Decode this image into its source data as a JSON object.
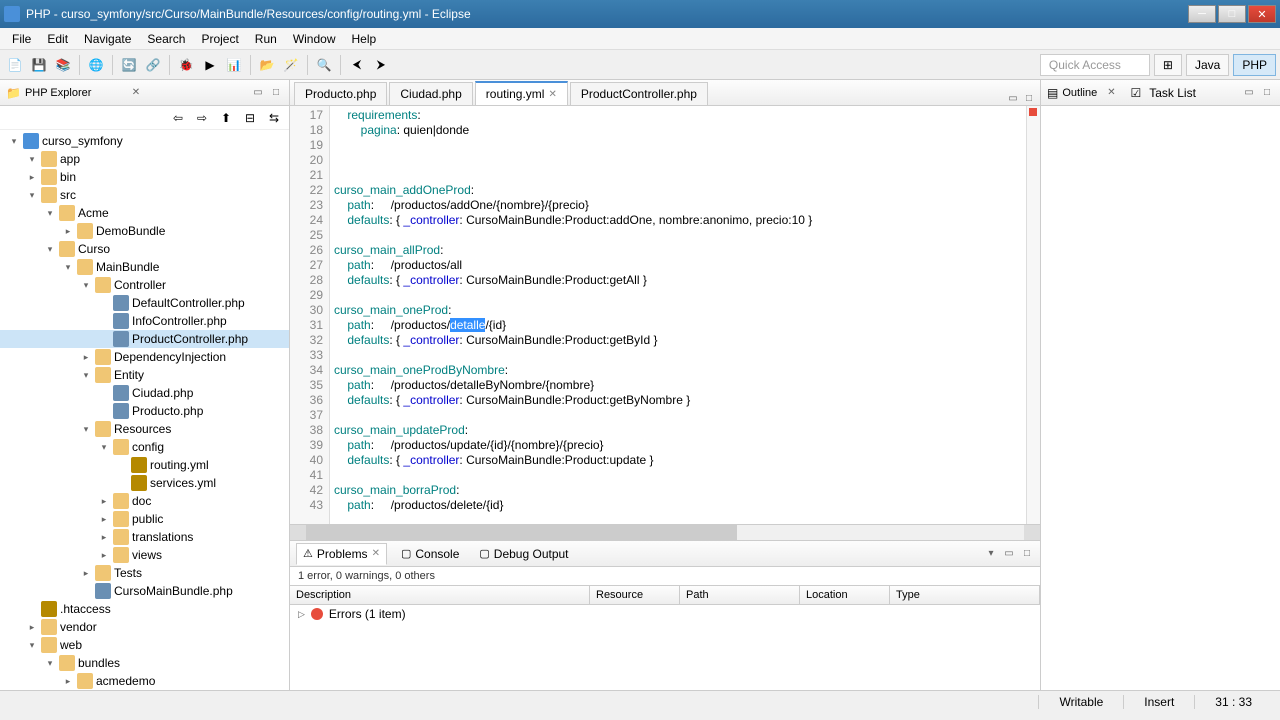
{
  "window": {
    "title": "PHP - curso_symfony/src/Curso/MainBundle/Resources/config/routing.yml - Eclipse"
  },
  "menubar": [
    "File",
    "Edit",
    "Navigate",
    "Search",
    "Project",
    "Run",
    "Window",
    "Help"
  ],
  "toolbar": {
    "quick_access": "Quick Access",
    "perspectives": [
      "Java",
      "PHP"
    ]
  },
  "explorer": {
    "title": "PHP Explorer",
    "tree": [
      {
        "d": 0,
        "exp": true,
        "icon": "proj",
        "label": "curso_symfony"
      },
      {
        "d": 1,
        "exp": true,
        "icon": "folder",
        "label": "app"
      },
      {
        "d": 1,
        "exp": false,
        "icon": "folder",
        "label": "bin"
      },
      {
        "d": 1,
        "exp": true,
        "icon": "folder",
        "label": "src"
      },
      {
        "d": 2,
        "exp": true,
        "icon": "folder",
        "label": "Acme"
      },
      {
        "d": 3,
        "exp": false,
        "icon": "folder",
        "label": "DemoBundle"
      },
      {
        "d": 2,
        "exp": true,
        "icon": "folder",
        "label": "Curso"
      },
      {
        "d": 3,
        "exp": true,
        "icon": "folder",
        "label": "MainBundle"
      },
      {
        "d": 4,
        "exp": true,
        "icon": "folder",
        "label": "Controller"
      },
      {
        "d": 5,
        "exp": false,
        "icon": "php",
        "label": "DefaultController.php"
      },
      {
        "d": 5,
        "exp": false,
        "icon": "php",
        "label": "InfoController.php"
      },
      {
        "d": 5,
        "exp": false,
        "icon": "php",
        "label": "ProductController.php",
        "sel": true
      },
      {
        "d": 4,
        "exp": false,
        "icon": "folder",
        "label": "DependencyInjection"
      },
      {
        "d": 4,
        "exp": true,
        "icon": "folder",
        "label": "Entity"
      },
      {
        "d": 5,
        "exp": false,
        "icon": "php",
        "label": "Ciudad.php"
      },
      {
        "d": 5,
        "exp": false,
        "icon": "php",
        "label": "Producto.php"
      },
      {
        "d": 4,
        "exp": true,
        "icon": "folder",
        "label": "Resources"
      },
      {
        "d": 5,
        "exp": true,
        "icon": "folder",
        "label": "config"
      },
      {
        "d": 6,
        "exp": false,
        "icon": "yml",
        "label": "routing.yml"
      },
      {
        "d": 6,
        "exp": false,
        "icon": "yml",
        "label": "services.yml"
      },
      {
        "d": 5,
        "exp": false,
        "icon": "folder",
        "label": "doc"
      },
      {
        "d": 5,
        "exp": false,
        "icon": "folder",
        "label": "public"
      },
      {
        "d": 5,
        "exp": false,
        "icon": "folder",
        "label": "translations"
      },
      {
        "d": 5,
        "exp": false,
        "icon": "folder",
        "label": "views"
      },
      {
        "d": 4,
        "exp": false,
        "icon": "folder",
        "label": "Tests"
      },
      {
        "d": 4,
        "exp": false,
        "icon": "php",
        "label": "CursoMainBundle.php"
      },
      {
        "d": 1,
        "exp": false,
        "icon": "yml",
        "label": ".htaccess"
      },
      {
        "d": 1,
        "exp": false,
        "icon": "folder",
        "label": "vendor"
      },
      {
        "d": 1,
        "exp": true,
        "icon": "folder",
        "label": "web"
      },
      {
        "d": 2,
        "exp": true,
        "icon": "folder",
        "label": "bundles"
      },
      {
        "d": 3,
        "exp": false,
        "icon": "folder",
        "label": "acmedemo"
      }
    ]
  },
  "editor": {
    "tabs": [
      {
        "label": "Producto.php",
        "active": false
      },
      {
        "label": "Ciudad.php",
        "active": false
      },
      {
        "label": "routing.yml",
        "active": true
      },
      {
        "label": "ProductController.php",
        "active": false
      }
    ],
    "first_line": 17,
    "lines": [
      "    requirements:",
      "        pagina: quien|donde",
      "",
      "",
      "",
      "curso_main_addOneProd:",
      "    path:     /productos/addOne/{nombre}/{precio}",
      "    defaults: { _controller: CursoMainBundle:Product:addOne, nombre:anonimo, precio:10 }",
      "",
      "curso_main_allProd:",
      "    path:     /productos/all",
      "    defaults: { _controller: CursoMainBundle:Product:getAll }",
      "",
      "curso_main_oneProd:",
      "    path:     /productos/detalle/{id}",
      "    defaults: { _controller: CursoMainBundle:Product:getById }",
      "",
      "curso_main_oneProdByNombre:",
      "    path:     /productos/detalleByNombre/{nombre}",
      "    defaults: { _controller: CursoMainBundle:Product:getByNombre }",
      "",
      "curso_main_updateProd:",
      "    path:     /productos/update/{id}/{nombre}/{precio}",
      "    defaults: { _controller: CursoMainBundle:Product:update }",
      "",
      "curso_main_borraProd:",
      "    path:     /productos/delete/{id}"
    ],
    "selection": {
      "line": 31,
      "text": "detalle"
    }
  },
  "outline": {
    "title": "Outline"
  },
  "tasklist": {
    "title": "Task List"
  },
  "problems": {
    "tabs": [
      "Problems",
      "Console",
      "Debug Output"
    ],
    "summary": "1 error, 0 warnings, 0 others",
    "columns": [
      "Description",
      "Resource",
      "Path",
      "Location",
      "Type"
    ],
    "error_row": "Errors (1 item)"
  },
  "statusbar": {
    "writable": "Writable",
    "insert": "Insert",
    "position": "31 : 33"
  }
}
